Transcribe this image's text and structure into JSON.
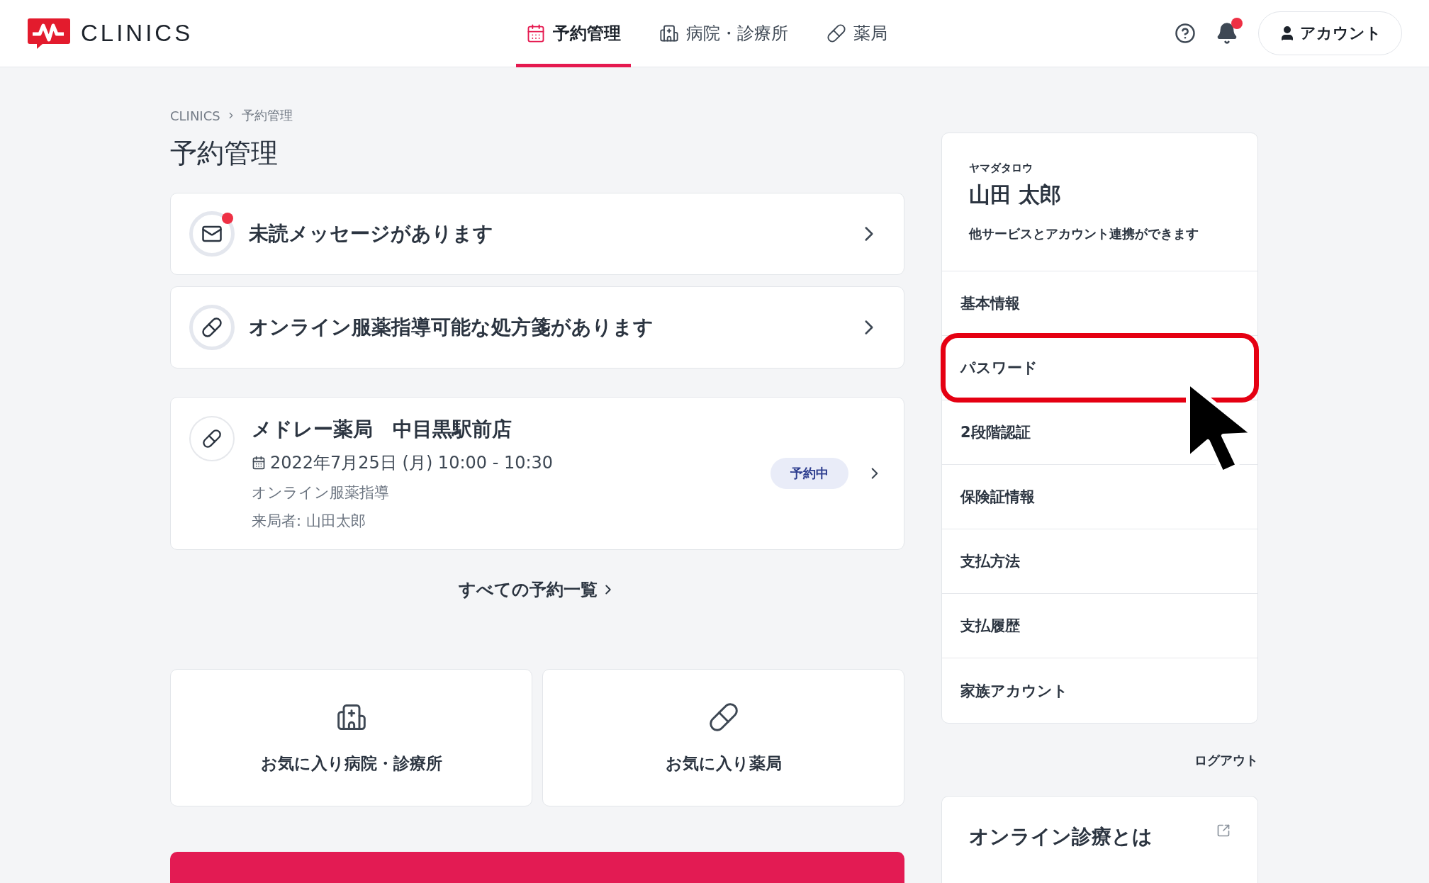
{
  "header": {
    "logo": "CLINICS",
    "nav": [
      {
        "label": "予約管理",
        "kind": "calendar",
        "selected": true
      },
      {
        "label": "病院・診療所",
        "kind": "hospital",
        "selected": false
      },
      {
        "label": "薬局",
        "kind": "pill",
        "selected": false
      }
    ],
    "notifications": {
      "unread": true
    },
    "account_button": "アカウント"
  },
  "breadcrumb": [
    "CLINICS",
    "予約管理"
  ],
  "page_title": "予約管理",
  "notices": [
    {
      "kind": "mail",
      "text": "未読メッセージがあります",
      "unread": true
    },
    {
      "kind": "pill",
      "text": "オンライン服薬指導可能な処方箋があります",
      "unread": false
    }
  ],
  "reservations": [
    {
      "pharmacy": "メドレー薬局　中目黒駅前店",
      "datetime": "2022年7月25日 (月) 10:00 - 10:30",
      "type": "オンライン服薬指導",
      "visitor": "来局者: 山田太郎",
      "status": "予約中"
    }
  ],
  "all_reservations_link": "すべての予約一覧",
  "favorites": [
    {
      "kind": "hospital",
      "label": "お気に入り病院・診療所"
    },
    {
      "kind": "pill",
      "label": "お気に入り薬局"
    }
  ],
  "account_panel": {
    "kana": "ヤマダタロウ",
    "name": "山田 太郎",
    "note": "他サービスとアカウント連携ができます",
    "menu": [
      {
        "label": "基本情報",
        "highlighted": false
      },
      {
        "label": "パスワード",
        "highlighted": true
      },
      {
        "label": "2段階認証",
        "highlighted": false
      },
      {
        "label": "保険証情報",
        "highlighted": false
      },
      {
        "label": "支払方法",
        "highlighted": false
      },
      {
        "label": "支払履歴",
        "highlighted": false
      },
      {
        "label": "家族アカウント",
        "highlighted": false
      }
    ]
  },
  "logout": "ログアウト",
  "info_card": {
    "title": "オンライン診療とは"
  }
}
